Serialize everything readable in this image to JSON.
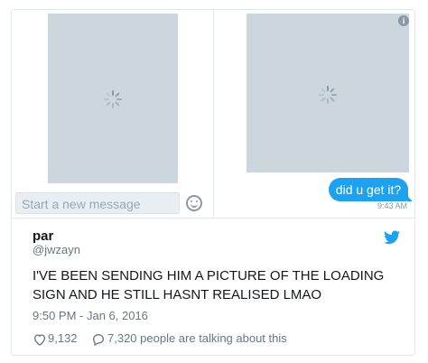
{
  "dm": {
    "composer_placeholder": "Start a new message",
    "sent_message": "did u get it?",
    "message_time": "9:43 AM",
    "icons": {
      "info": "info-icon",
      "emoji": "emoji-icon",
      "spinner": "loading-spinner-icon"
    }
  },
  "tweet": {
    "name": "par",
    "handle": "@jwzayn",
    "text": "I'VE BEEN SENDING HIM A PICTURE OF THE LOADING SIGN AND HE STILL HASNT REALISED LMAO",
    "timestamp": "9:50 PM - Jan 6, 2016",
    "likes": "9,132",
    "talking": "7,320 people are talking about this",
    "brand_color": "#1da1f2",
    "icons": {
      "brand": "twitter-bird-icon",
      "like": "heart-icon",
      "reply": "reply-icon"
    }
  }
}
